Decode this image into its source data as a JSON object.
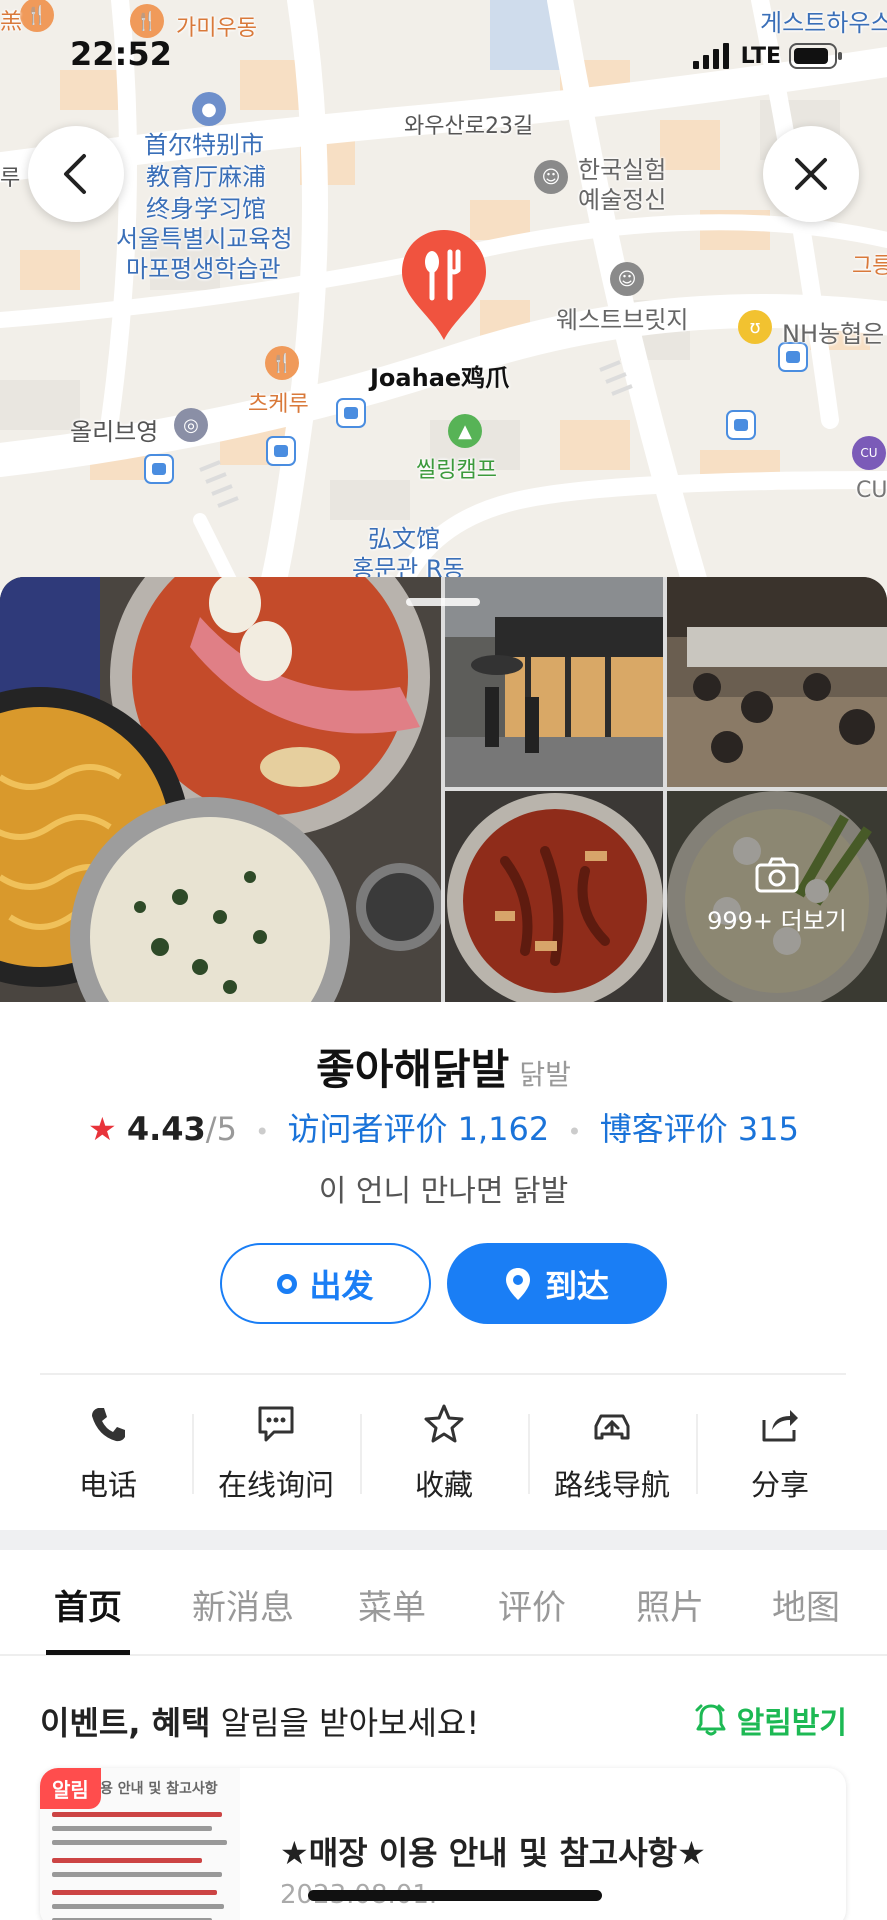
{
  "status_bar": {
    "time": "22:52",
    "network": "LTE"
  },
  "map": {
    "labels": {
      "gami_udong": "가미우동",
      "guesthouse": "게스트하우스",
      "road_waeusanro": "와우산로23길",
      "edu_cn_1": "首尔特别市",
      "edu_cn_2": "教育厅麻浦",
      "edu_cn_3": "终身学习馆",
      "edu_kr_1": "서울특별시교육청",
      "edu_kr_2": "마포평생학습관",
      "korea_experiment_1": "한국실험",
      "korea_experiment_2": "예술정신",
      "west_bridge": "웨스트브릿지",
      "nh_bank": "NH농협은",
      "place_pin": "Joahae鸡爪",
      "skeru": "츠케루",
      "olive_young": "올리브영",
      "ssiling_camp": "씰링캠프",
      "hongmun_1": "弘文馆",
      "hongmun_2": "홍문관 R동",
      "cu_store": "CU",
      "edge_left": "羔",
      "edge_left2": "人",
      "edge_left3": "루",
      "edge_right": "그릉"
    }
  },
  "photos": {
    "more_label": "999+ 더보기"
  },
  "place": {
    "name": "좋아해닭발",
    "category": "닭발",
    "rating": "4.43",
    "rating_max": "/5",
    "visitor_reviews": "访问者评价 1,162",
    "blog_reviews": "博客评价 315",
    "tagline": "이 언니 만나면 닭발"
  },
  "route": {
    "depart": "出发",
    "arrive": "到达"
  },
  "actions": [
    {
      "label": "电话",
      "icon": "phone-icon"
    },
    {
      "label": "在线询问",
      "icon": "chat-icon"
    },
    {
      "label": "收藏",
      "icon": "star-icon"
    },
    {
      "label": "路线导航",
      "icon": "car-route-icon"
    },
    {
      "label": "分享",
      "icon": "share-icon"
    }
  ],
  "tabs": [
    "首页",
    "新消息",
    "菜单",
    "评价",
    "照片",
    "地图"
  ],
  "event": {
    "title_bold": "이벤트, 혜택",
    "title_rest": " 알림을 받아보세요!",
    "notify": "알림받기",
    "badge": "알림",
    "thumb_heading": "용 안내 및 참고사항",
    "card_title": "★매장 이용 안내 및 참고사항★",
    "card_date": "2023.08.01."
  },
  "colors": {
    "accent_blue": "#1a7ef5",
    "pin_red": "#f0533f",
    "notify_green": "#1db954",
    "star_red": "#e8333a"
  }
}
